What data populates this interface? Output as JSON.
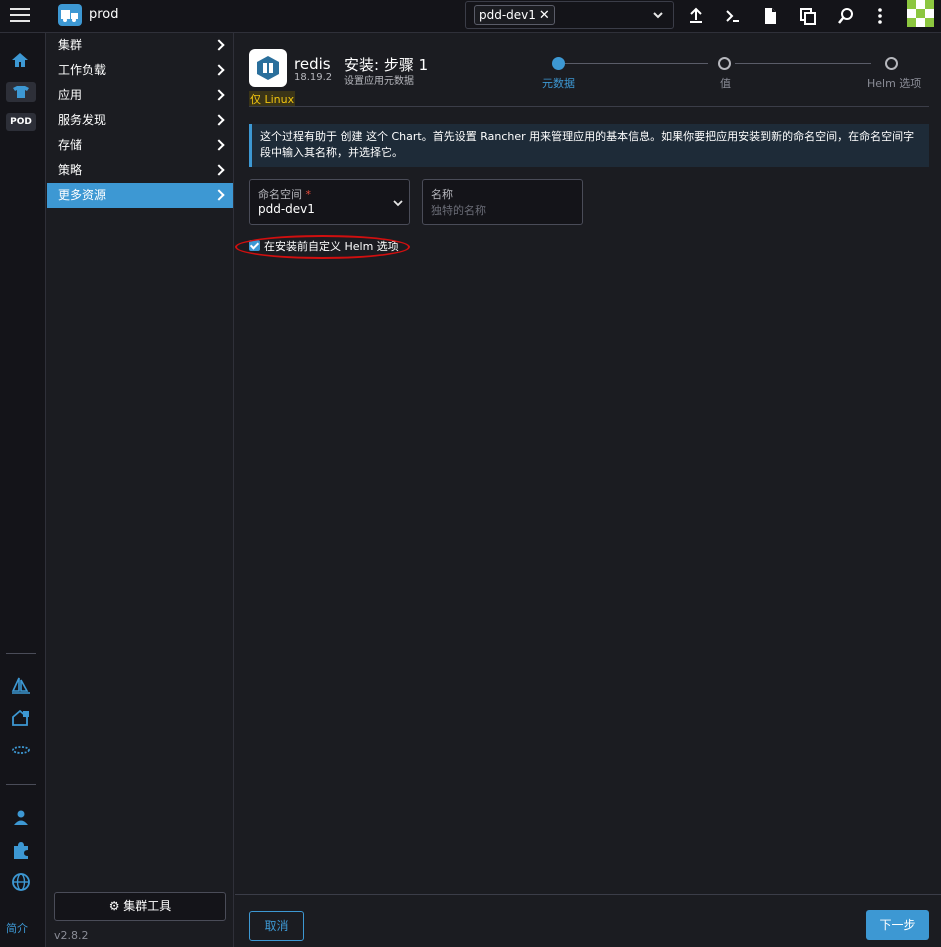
{
  "topbar": {
    "cluster_name": "prod",
    "namespace_chip": "pdd-dev1",
    "icons": [
      "import-yaml-icon",
      "kubectl-shell-icon",
      "kubeconfig-file-icon",
      "copy-kubeconfig-icon",
      "search-icon",
      "more-icon"
    ]
  },
  "rail": {
    "pod_badge": "POD",
    "bottom_link": "简介"
  },
  "sidenav": {
    "items": [
      {
        "label": "集群"
      },
      {
        "label": "工作负载"
      },
      {
        "label": "应用"
      },
      {
        "label": "服务发现"
      },
      {
        "label": "存储"
      },
      {
        "label": "策略"
      },
      {
        "label": "更多资源"
      }
    ],
    "active_index": 6,
    "cluster_tools": "集群工具",
    "version": "v2.8.2"
  },
  "app": {
    "name": "redis",
    "version": "18.19.2",
    "os_badge": "仅 Linux"
  },
  "step": {
    "title": "安装: 步骤 1",
    "subtitle": "设置应用元数据"
  },
  "wizard": {
    "steps": [
      {
        "label": "元数据",
        "active": true
      },
      {
        "label": "值",
        "active": false
      },
      {
        "label": "Helm 选项",
        "active": false
      }
    ]
  },
  "banner": {
    "text": "这个过程有助于 创建 这个 Chart。首先设置 Rancher 用来管理应用的基本信息。如果你要把应用安装到新的命名空间，在命名空间字段中输入其名称，并选择它。"
  },
  "form": {
    "namespace": {
      "label": "命名空间",
      "required_mark": "*",
      "value": "pdd-dev1"
    },
    "name": {
      "label": "名称",
      "placeholder": "独特的名称"
    },
    "customize_helm": {
      "label": "在安装前自定义 Helm 选项",
      "checked": true
    }
  },
  "footer": {
    "cancel": "取消",
    "next": "下一步"
  },
  "colors": {
    "accent": "#3d98d3",
    "annotation": "#d10f0f",
    "badge": "#f1c40f"
  }
}
